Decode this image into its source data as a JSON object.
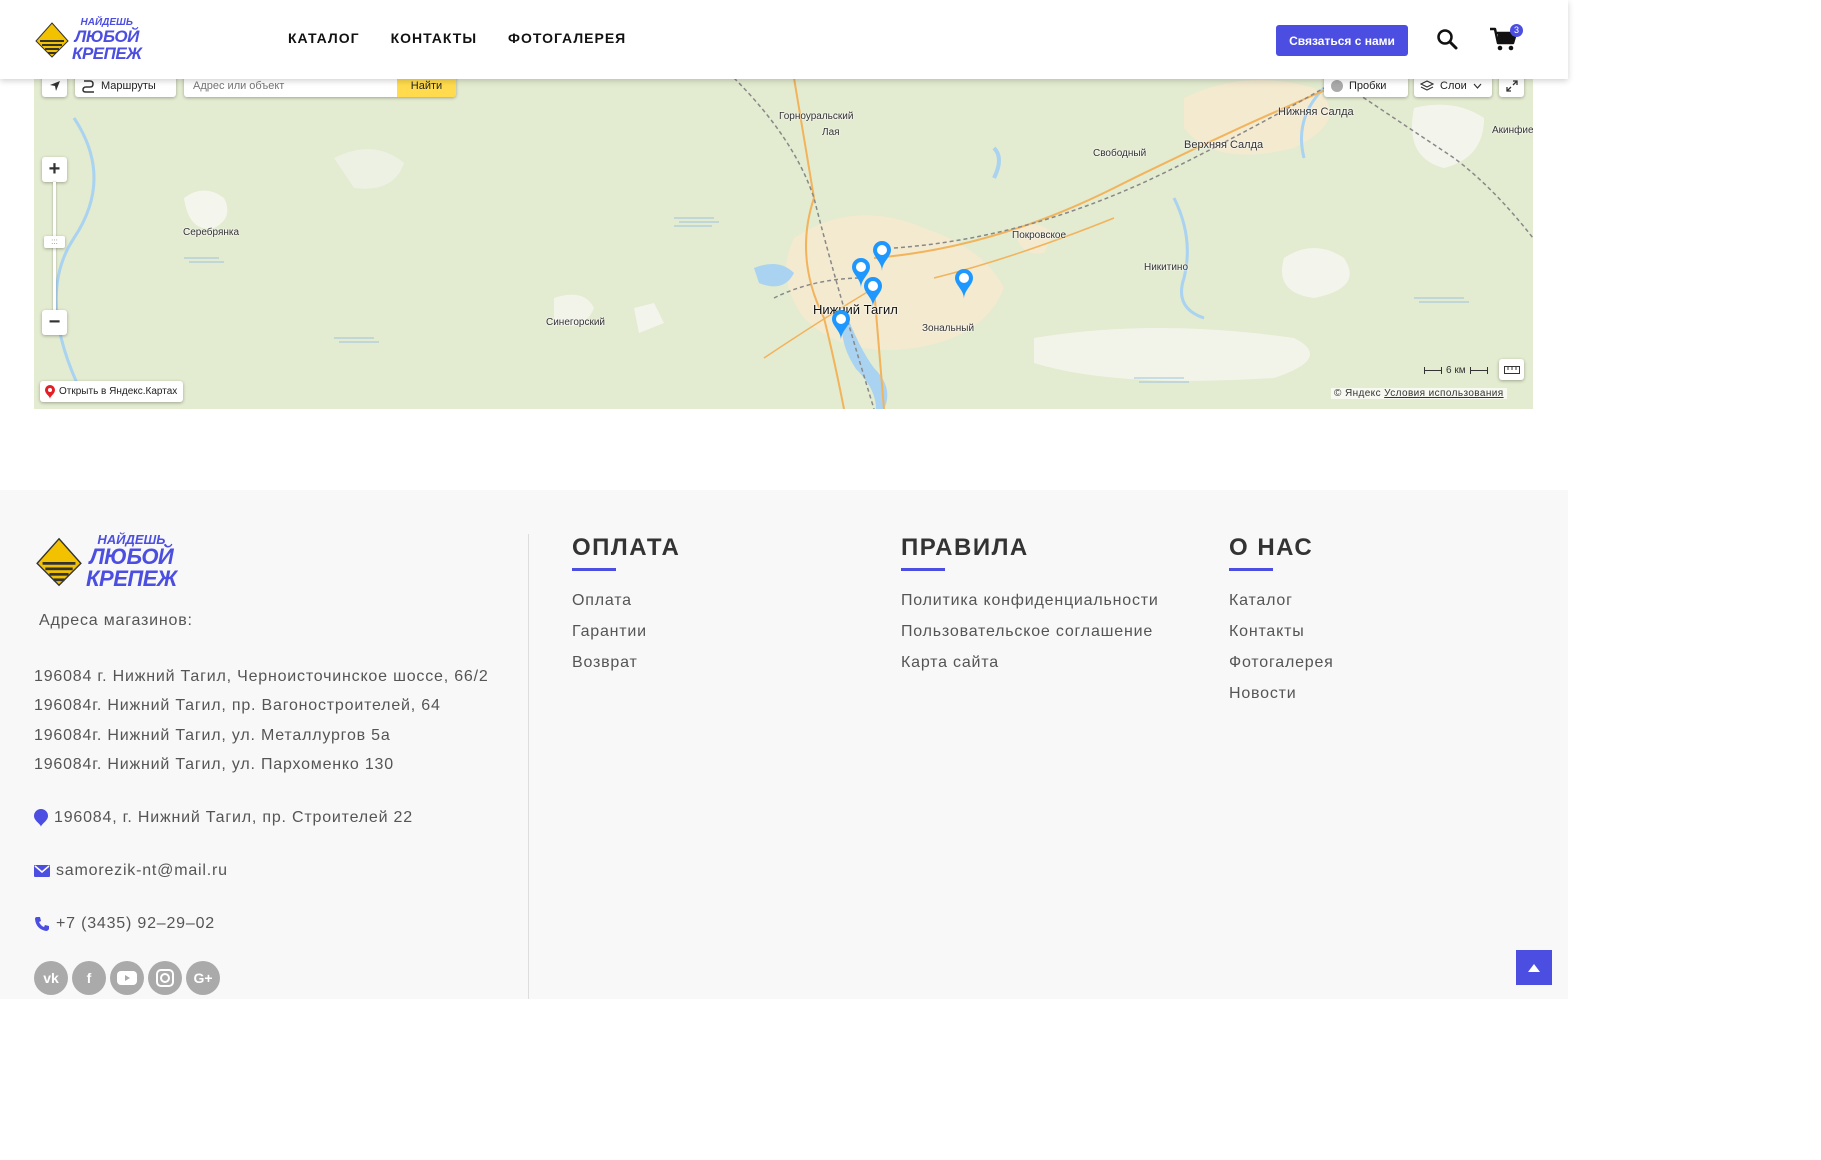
{
  "header": {
    "logo": {
      "line1": "НАЙДЕШЬ",
      "line2": "ЛЮБОЙ",
      "line3": "КРЕПЕЖ"
    },
    "nav": [
      "КАТАЛОГ",
      "КОНТАКТЫ",
      "ФОТОГАЛЕРЕЯ"
    ],
    "contact_button": "Связаться с нами",
    "cart_count": "3"
  },
  "map": {
    "routes_label": "Маршруты",
    "search_placeholder": "Адрес или объект",
    "search_button": "Найти",
    "traffic_label": "Пробки",
    "layers_label": "Слои",
    "open_in_yandex": "Открыть в Яндекс.Картах",
    "scale": "6 км",
    "copyright": "© Яндекс",
    "terms": "Условия использования",
    "labels": {
      "gornouralsky": "Горноуральский",
      "laya": "Лая",
      "svobodny": "Свободный",
      "verkhnyaya_salda": "Верхняя Салда",
      "nizhnyaya_salda": "Нижняя Салда",
      "akinfievo": "Акинфие",
      "serebryanka": "Серебрянка",
      "pokrovskoe": "Покровское",
      "nikitino": "Никитино",
      "sinegorsky": "Синегорский",
      "nizhny_tagil": "Нижний Тагил",
      "zonalny": "Зональный"
    }
  },
  "footer": {
    "logo": {
      "line1": "НАЙДЕШЬ",
      "line2": "ЛЮБОЙ",
      "line3": "КРЕПЕЖ"
    },
    "addresses_title": "Адреса магазинов:",
    "addresses": [
      "196084 г. Нижний Тагил, Черноисточинское шоссе, 66/2",
      "196084г. Нижний Тагил, пр. Вагоностроителей, 64",
      "196084г. Нижний Тагил, ул. Металлургов 5а",
      "196084г. Нижний Тагил, ул. Пархоменко 130"
    ],
    "main_address": "196084, г. Нижний Тагил, пр. Строителей 22",
    "email": "samorezik-nt@mail.ru",
    "phone": "+7 (3435) 92–29–02",
    "social": [
      "vk-icon",
      "facebook-icon",
      "youtube-icon",
      "instagram-icon",
      "google-plus-icon"
    ],
    "columns": [
      {
        "title": "ОПЛАТА",
        "links": [
          "Оплата",
          "Гарантии",
          "Возврат"
        ]
      },
      {
        "title": "ПРАВИЛА",
        "links": [
          "Политика конфиденциальности",
          "Пользовательское соглашение",
          "Карта сайта"
        ]
      },
      {
        "title": "О НАС",
        "links": [
          "Каталог",
          "Контакты",
          "Фотогалерея",
          "Новости"
        ]
      }
    ]
  },
  "colors": {
    "accent": "#4b4ee0",
    "yandex_button": "#ffdb4d",
    "pin": "#1e98ff"
  }
}
